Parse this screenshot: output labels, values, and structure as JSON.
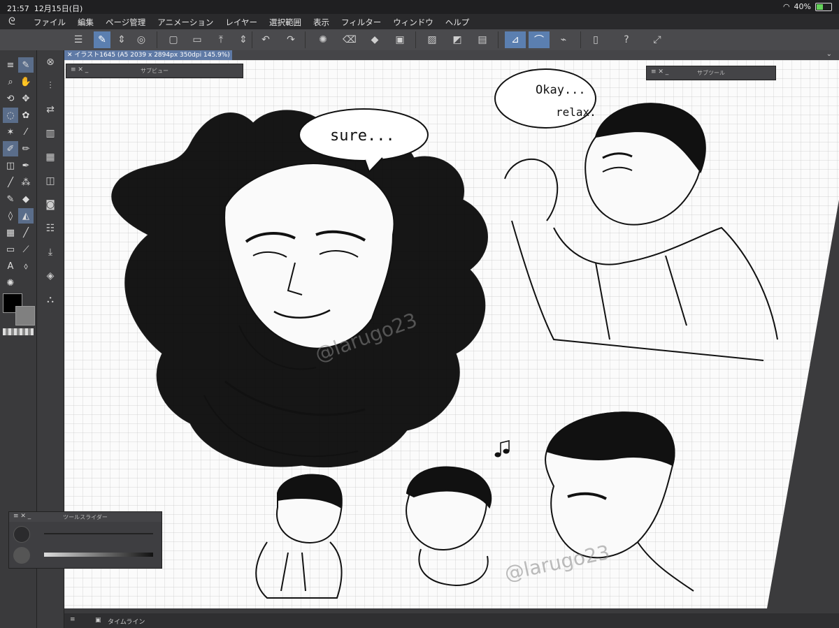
{
  "status_bar": {
    "time": "21:57",
    "date": "12月15日(日)",
    "battery": "40%"
  },
  "menu": [
    "ファイル",
    "編集",
    "ページ管理",
    "アニメーション",
    "レイヤー",
    "選択範囲",
    "表示",
    "フィルター",
    "ウィンドウ",
    "ヘルプ"
  ],
  "document_tab": {
    "title": "イラスト1645 (A5 2039 x 2894px 350dpi 145.9%)"
  },
  "panels": {
    "subview": {
      "title": "サブビュー"
    },
    "subtool": {
      "title": "サブツール"
    },
    "tool_slider": {
      "title": "ツールスライダー"
    }
  },
  "timeline": {
    "title": "タイムライン"
  },
  "drawing": {
    "speech_1": "sure...",
    "speech_2_line1": "Okay...",
    "speech_2_line2": "relax.",
    "watermark": "@larugo23"
  },
  "colors": {
    "accent": "#5b7fb0",
    "main_color": "#000000",
    "sub_color": "#808080"
  }
}
